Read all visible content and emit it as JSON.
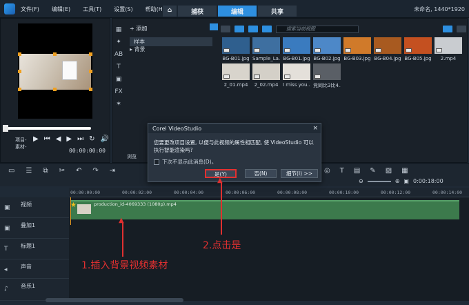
{
  "menu": [
    "文件(F)",
    "编辑(E)",
    "工具(T)",
    "设置(S)",
    "帮助(H)"
  ],
  "tabs": {
    "home": "⌂",
    "capture": "捕获",
    "edit": "编辑",
    "share": "共享"
  },
  "project_info": "未命名, 1440*1920",
  "preview": {
    "labels": [
      "项目-",
      "素材-"
    ],
    "timecode": "00:00:00:00",
    "in_label": "V"
  },
  "library": {
    "add_label": "添加",
    "tree": {
      "selected": "样本",
      "child": "背景"
    },
    "search_placeholder": "搜索当前视图",
    "thumbs": [
      {
        "name": "BG-B01.jpg",
        "color": "#2f5f8e"
      },
      {
        "name": "Sample_La...",
        "color": "#3e6fa0"
      },
      {
        "name": "BG-B01.jpg",
        "color": "#3a7bbf"
      },
      {
        "name": "BG-B02.jpg",
        "color": "#4d88c8"
      },
      {
        "name": "BG-B03.jpg",
        "color": "#d07a2a"
      },
      {
        "name": "BG-B04.jpg",
        "color": "#a85a20"
      },
      {
        "name": "BG-B05.jpg",
        "color": "#c45020"
      },
      {
        "name": "2.mp4",
        "color": "#c9ccd0"
      },
      {
        "name": "2_01.mp4",
        "color": "#d8d4cc"
      },
      {
        "name": "2_02.mp4",
        "color": "#d4d0c8"
      },
      {
        "name": "I miss you...",
        "color": "#e4e0da"
      },
      {
        "name": "竞同比3比4...",
        "color": "#5a5f66"
      }
    ],
    "browse_label": "浏览"
  },
  "dialog": {
    "title": "Corel VideoStudio",
    "close": "×",
    "message": "您要更改项目设置, 以便与此视频的属性相匹配, 使 VideoStudio 可以执行智能渲染吗?",
    "checkbox": "下次不显示此消息(D)。",
    "yes": "是(Y)",
    "no": "否(N)",
    "details": "细节(I) >>"
  },
  "timeline": {
    "ruler": [
      "00:00:00:00",
      "00:00:02:00",
      "00:00:04:00",
      "00:00:06:00",
      "00:00:08:00",
      "00:00:10:00",
      "00:00:12:00",
      "00:00:14:00"
    ],
    "zoom_time": "0:00:18:00",
    "tracks": [
      "视频",
      "叠加1",
      "标题1",
      "声音",
      "音乐1"
    ],
    "clip_name": "production_id-4069333 (1080p).mp4"
  },
  "annotations": {
    "step1": "1.插入背景视频素材",
    "step2": "2.点击是"
  }
}
